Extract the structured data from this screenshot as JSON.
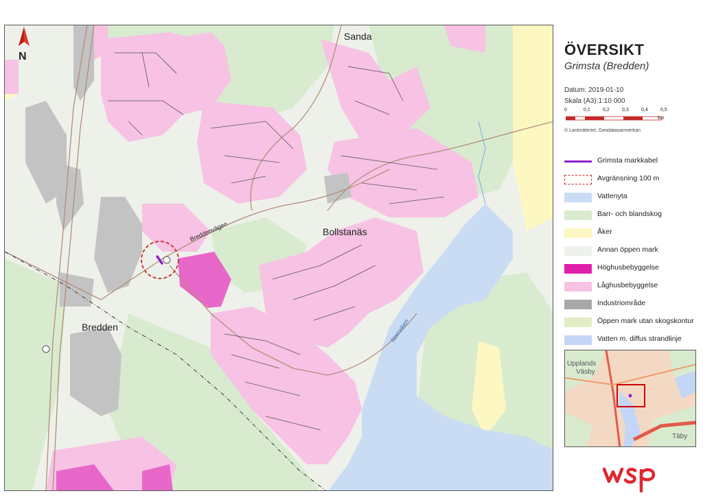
{
  "map": {
    "north_label": "N",
    "places": {
      "sanda": "Sanda",
      "bollstanas": "Bollstanäs",
      "bredden": "Bredden",
      "breddenvagen": "Breddenvägen",
      "norrviken": "Norrviken"
    },
    "colors": {
      "water": "#c9dcf4",
      "forest": "#d8ebcf",
      "open": "#eef1ea",
      "low_rise": "#f7c2e4",
      "high_rise": "#e868c9",
      "industrial": "#c3c3c3",
      "field": "#fdf7c2",
      "cable": "#8e1fc9",
      "boundary": "#c62828"
    }
  },
  "panel": {
    "title": "ÖVERSIKT",
    "subtitle": "Grimsta (Bredden)",
    "date_label": "Datum: 2019-01-10",
    "scale_label": "Skala (A3):1:10 000",
    "scale_ticks": [
      "0",
      "0,1",
      "0,2",
      "0,3",
      "0,4",
      "0,5"
    ],
    "scale_unit": "km",
    "credit": "© Lantmäteriet, Geodatasamverkan"
  },
  "legend": [
    {
      "label": "Grimsta markkabel",
      "type": "line",
      "color": "#8e1fc9"
    },
    {
      "label": "Avgränsning 100 m",
      "type": "dashed",
      "color": "#c62828"
    },
    {
      "label": "Vattenyta",
      "type": "fill",
      "color": "#c9dcf4"
    },
    {
      "label": "Barr- och blandskog",
      "type": "fill",
      "color": "#d8ebcf"
    },
    {
      "label": "Åker",
      "type": "fill",
      "color": "#fdf7c2"
    },
    {
      "label": "Annan öppen mark",
      "type": "fill",
      "color": "#eef1ea"
    },
    {
      "label": "Höghusbebyggelse",
      "type": "fill",
      "color": "#e01fa8"
    },
    {
      "label": "Låghusbebyggelse",
      "type": "fill",
      "color": "#f7c2e4"
    },
    {
      "label": "Industriområde",
      "type": "fill",
      "color": "#a8a8a8"
    },
    {
      "label": "Öppen mark utan skogskontur",
      "type": "fill",
      "color": "#e2edc4"
    },
    {
      "label": "Vatten m. diffus strandlinje",
      "type": "fill",
      "color": "#c4d6f6"
    }
  ],
  "overview": {
    "label_upplands": "Upplands",
    "label_vasby": "Väsby",
    "label_taby": "Täby"
  },
  "logo": {
    "text": "wsp",
    "color": "#e0262e"
  }
}
